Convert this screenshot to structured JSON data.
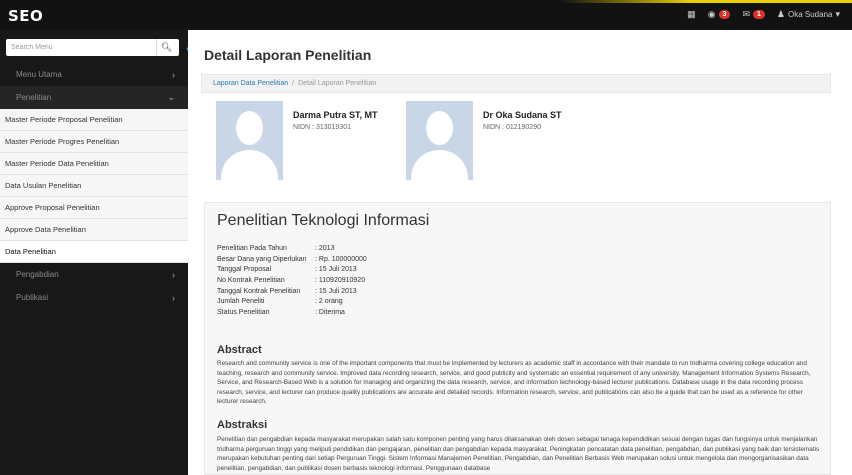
{
  "brand": "SEO",
  "topbar": {
    "notif_count": "3",
    "mail_count": "1",
    "user_name": "Oka Sudana"
  },
  "sidebar": {
    "search_placeholder": "Search Menu",
    "items": [
      {
        "label": "Menu Utama"
      },
      {
        "label": "Penelitian"
      },
      {
        "label": "Pengabdian"
      },
      {
        "label": "Publikasi"
      }
    ],
    "submenu": [
      {
        "label": "Master Periode Proposal Penelitian"
      },
      {
        "label": "Master Periode Progres Penelitian"
      },
      {
        "label": "Master Periode Data Penelitian"
      },
      {
        "label": "Data Usulan Penelitian"
      },
      {
        "label": "Approve Proposal Penelitian"
      },
      {
        "label": "Approve Data Penelitian"
      },
      {
        "label": "Data Penelitian"
      }
    ]
  },
  "page": {
    "title": "Detail Laporan Penelitian",
    "breadcrumb_link": "Laporan Data Penelitian",
    "breadcrumb_sep": "/",
    "breadcrumb_current": "Detail Laporan Penelitian"
  },
  "persons": [
    {
      "name": "Darma Putra ST, MT",
      "nidn": "NIDN : 313019301"
    },
    {
      "name": "Dr Oka Sudana ST",
      "nidn": "NIDN : 012190290"
    }
  ],
  "research": {
    "title": "Penelitian Teknologi Informasi",
    "rows": [
      {
        "label": "Penelitian Pada Tahun",
        "value": ": 2013"
      },
      {
        "label": "Besar Dana yang Diperlukan",
        "value": ": Rp. 100000000"
      },
      {
        "label": "Tanggal Proposal",
        "value": ": 15 Juli 2013"
      },
      {
        "label": "No Kontrak Penelitian",
        "value": ": 110920910920"
      },
      {
        "label": "Tanggal Kontrak Penelitian",
        "value": ": 15 Juli 2013"
      },
      {
        "label": "Jumlah Peneliti",
        "value": ": 2 orang"
      },
      {
        "label": "Status Penelitian",
        "value": ": Diterima"
      }
    ],
    "abstract_title": "Abstract",
    "abstract_text": "Research and community service is one of the important components that must be implemented by lecturers as academic staff in accordance with their mandate to run tridharma covering college education and teaching, research and community service. Improved data recording research, service, and good publicity and systematic an essential requirement of any university. Management Information Systems Research, Service, and Research-Based Web is a solution for managing and organizing the data research, service, and information technology-based lecturer publications. Database usage in the data recording process research, service, and lecturer can produce quality publications are accurate and detailed records. Information research, service, and publications can also be a guide that can be used as a reference for other lecturer research.",
    "abstraksi_title": "Abstraksi",
    "abstraksi_text": "Penelitian dan pengabdian kepada masyarakat merupakan salah satu komponen penting yang harus dilaksanakan oleh dosen sebagai tenaga kependidikan sesuai dengan tugas dan fungsinya untuk menjalankan tridharma perguruan tinggi yang meliputi pendidikan dan pengajaran, penelitian dan pengabdian kepada masyarakat. Peningkatan pencatatan data penelitian, pengabdian, dan publikasi yang baik dan tersistematis merupakan kebutuhan penting dari setiap Perguruan Tinggi. Sistem Informasi Manajemen Penelitian, Pengabdian, dan Penelitian Berbasis Web merupakan solusi untuk mengelola dan mengorganisasikan data penelitian, pengabdian, dan publikasi dosen berbasis teknologi informasi. Penggunaan database"
  }
}
